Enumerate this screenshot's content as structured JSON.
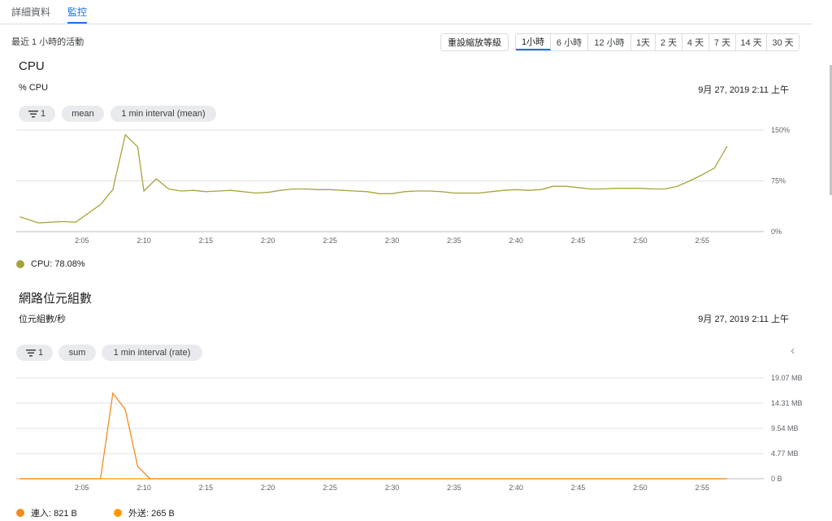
{
  "tabs": [
    {
      "label": "詳細資料"
    },
    {
      "label": "監控"
    }
  ],
  "activity_label": "最近 1 小時的活動",
  "reset_button": "重設縮放等級",
  "time_ranges": [
    "1小時",
    "6 小時",
    "12 小時",
    "1天",
    "2 天",
    "4 天",
    "7 天",
    "14 天",
    "30 天"
  ],
  "active_range": "1小時",
  "colors": {
    "accent": "#1a73e8",
    "cpu_series": "#a8a33c",
    "network_series": "#f28c1c"
  },
  "cpu_chart": {
    "title": "CPU",
    "subtitle": "% CPU",
    "date": "9月 27, 2019 2:11 上午",
    "chips": {
      "filter": "1",
      "aggregator": "mean",
      "interval": "1 min interval (mean)"
    },
    "legend": "CPU: 78.08%"
  },
  "network_chart": {
    "title": "網路位元組數",
    "subtitle": "位元組數/秒",
    "date": "9月 27, 2019 2:11 上午",
    "chips": {
      "filter": "1",
      "aggregator": "sum",
      "interval": "1 min interval (rate)"
    },
    "legend_in": "連入: 821 B",
    "legend_out": "外送: 265 B"
  },
  "chart_data": [
    {
      "type": "line",
      "title": "CPU",
      "ylabel": "% CPU",
      "x_start": 0,
      "x_end": 57,
      "xticks": [
        {
          "t": 5,
          "label": "2:05"
        },
        {
          "t": 10,
          "label": "2:10"
        },
        {
          "t": 15,
          "label": "2:15"
        },
        {
          "t": 20,
          "label": "2:20"
        },
        {
          "t": 25,
          "label": "2:25"
        },
        {
          "t": 30,
          "label": "2:30"
        },
        {
          "t": 35,
          "label": "2:35"
        },
        {
          "t": 40,
          "label": "2:40"
        },
        {
          "t": 45,
          "label": "2:45"
        },
        {
          "t": 50,
          "label": "2:50"
        },
        {
          "t": 55,
          "label": "2:55"
        }
      ],
      "yticks": [
        {
          "v": 0,
          "label": "0%"
        },
        {
          "v": 75,
          "label": "75%"
        },
        {
          "v": 150,
          "label": "150%"
        }
      ],
      "ylim": [
        0,
        150
      ],
      "grid": true,
      "series": [
        {
          "name": "CPU",
          "color": "#a8a33c",
          "points": [
            [
              0,
              22
            ],
            [
              1.5,
              13
            ],
            [
              3.5,
              15
            ],
            [
              4.5,
              14
            ],
            [
              6.5,
              40
            ],
            [
              7.5,
              62
            ],
            [
              8.5,
              143
            ],
            [
              9.5,
              125
            ],
            [
              10,
              60
            ],
            [
              11,
              78
            ],
            [
              12,
              63
            ],
            [
              13,
              60
            ],
            [
              14,
              61
            ],
            [
              15,
              59
            ],
            [
              16,
              60
            ],
            [
              17,
              61
            ],
            [
              18,
              59
            ],
            [
              19,
              57
            ],
            [
              20,
              58
            ],
            [
              21,
              61
            ],
            [
              22,
              63
            ],
            [
              23,
              63
            ],
            [
              24,
              62
            ],
            [
              25,
              62
            ],
            [
              26,
              61
            ],
            [
              27,
              60
            ],
            [
              28,
              59
            ],
            [
              29,
              56
            ],
            [
              30,
              56
            ],
            [
              31,
              59
            ],
            [
              32,
              60
            ],
            [
              33,
              60
            ],
            [
              34,
              59
            ],
            [
              35,
              57
            ],
            [
              36,
              57
            ],
            [
              37,
              57
            ],
            [
              38,
              59
            ],
            [
              39,
              61
            ],
            [
              40,
              62
            ],
            [
              41,
              61
            ],
            [
              42,
              62
            ],
            [
              43,
              67
            ],
            [
              44,
              67
            ],
            [
              45,
              65
            ],
            [
              46,
              63
            ],
            [
              47,
              63
            ],
            [
              48,
              64
            ],
            [
              49,
              64
            ],
            [
              50,
              64
            ],
            [
              51,
              63
            ],
            [
              52,
              63
            ],
            [
              53,
              67
            ],
            [
              54,
              75
            ],
            [
              55,
              84
            ],
            [
              56,
              94
            ],
            [
              57,
              126
            ]
          ]
        }
      ]
    },
    {
      "type": "line",
      "title": "網路位元組數",
      "ylabel": "位元組數/秒",
      "x_start": 0,
      "x_end": 57,
      "xticks": [
        {
          "t": 5,
          "label": "2:05"
        },
        {
          "t": 10,
          "label": "2:10"
        },
        {
          "t": 15,
          "label": "2:15"
        },
        {
          "t": 20,
          "label": "2:20"
        },
        {
          "t": 25,
          "label": "2:25"
        },
        {
          "t": 30,
          "label": "2:30"
        },
        {
          "t": 35,
          "label": "2:35"
        },
        {
          "t": 40,
          "label": "2:40"
        },
        {
          "t": 45,
          "label": "2:45"
        },
        {
          "t": 50,
          "label": "2:50"
        },
        {
          "t": 55,
          "label": "2:55"
        }
      ],
      "yticks": [
        {
          "v": 0,
          "label": "0 B"
        },
        {
          "v": 4.77,
          "label": "4.77 MB"
        },
        {
          "v": 9.54,
          "label": "9.54 MB"
        },
        {
          "v": 14.31,
          "label": "14.31 MB"
        },
        {
          "v": 19.07,
          "label": "19.07 MB"
        }
      ],
      "ylim": [
        0,
        19.07
      ],
      "grid": true,
      "series": [
        {
          "name": "外送",
          "color": "#ff9800",
          "points": [
            [
              0,
              0
            ],
            [
              57,
              0
            ]
          ]
        },
        {
          "name": "連入",
          "color": "#f28c1c",
          "points": [
            [
              0,
              0
            ],
            [
              6.5,
              0
            ],
            [
              7.5,
              16.2
            ],
            [
              8.5,
              13.1
            ],
            [
              9.5,
              2.3
            ],
            [
              10.5,
              0
            ],
            [
              57,
              0
            ]
          ]
        }
      ]
    }
  ]
}
